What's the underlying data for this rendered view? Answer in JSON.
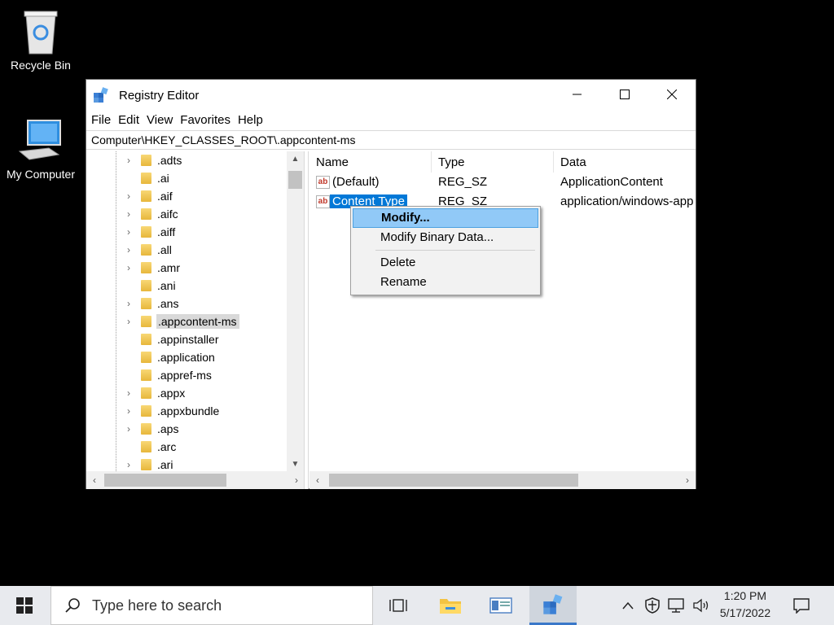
{
  "desktop": {
    "icons": [
      {
        "label": "Recycle Bin",
        "icon": "recycle-bin-icon"
      },
      {
        "label": "My Computer",
        "icon": "computer-icon"
      }
    ]
  },
  "window": {
    "title": "Registry Editor",
    "menu": [
      "File",
      "Edit",
      "View",
      "Favorites",
      "Help"
    ],
    "address": "Computer\\HKEY_CLASSES_ROOT\\.appcontent-ms",
    "tree": {
      "items": [
        ".adts",
        ".ai",
        ".aif",
        ".aifc",
        ".aiff",
        ".all",
        ".amr",
        ".ani",
        ".ans",
        ".appcontent-ms",
        ".appinstaller",
        ".application",
        ".appref-ms",
        ".appx",
        ".appxbundle",
        ".aps",
        ".arc",
        ".ari"
      ],
      "selected": ".appcontent-ms"
    },
    "list": {
      "columns": [
        "Name",
        "Type",
        "Data"
      ],
      "rows": [
        {
          "name": "(Default)",
          "type": "REG_SZ",
          "data": "ApplicationContent"
        },
        {
          "name": "Content Type",
          "type": "REG_SZ",
          "data": "application/windows-app"
        }
      ]
    }
  },
  "context_menu": {
    "items": [
      "Modify...",
      "Modify Binary Data...",
      "Delete",
      "Rename"
    ]
  },
  "taskbar": {
    "search_placeholder": "Type here to search",
    "time": "1:20 PM",
    "date": "5/17/2022"
  },
  "colors": {
    "selection": "#0078d7",
    "menu_highlight": "#91c9f7",
    "taskbar": "#e8eaee"
  }
}
